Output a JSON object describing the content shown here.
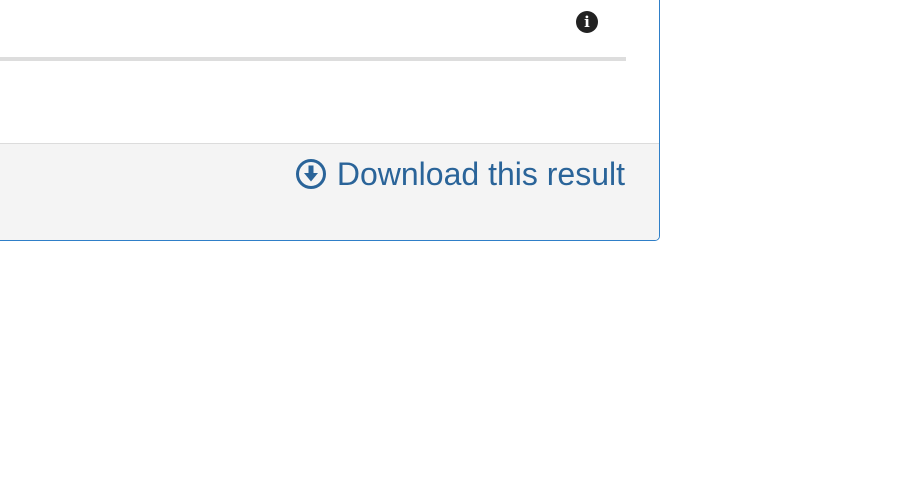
{
  "panel": {
    "info_icon": "info-circle-icon",
    "info_glyph": "i",
    "progress_fraction": 1.0
  },
  "footer": {
    "download_icon": "download-circle-icon",
    "download_label": "Download this result"
  },
  "colors": {
    "accent": "#2a6499",
    "panel_border": "#2f7fc8",
    "footer_bg": "#f4f4f4",
    "track": "#dddddd"
  }
}
